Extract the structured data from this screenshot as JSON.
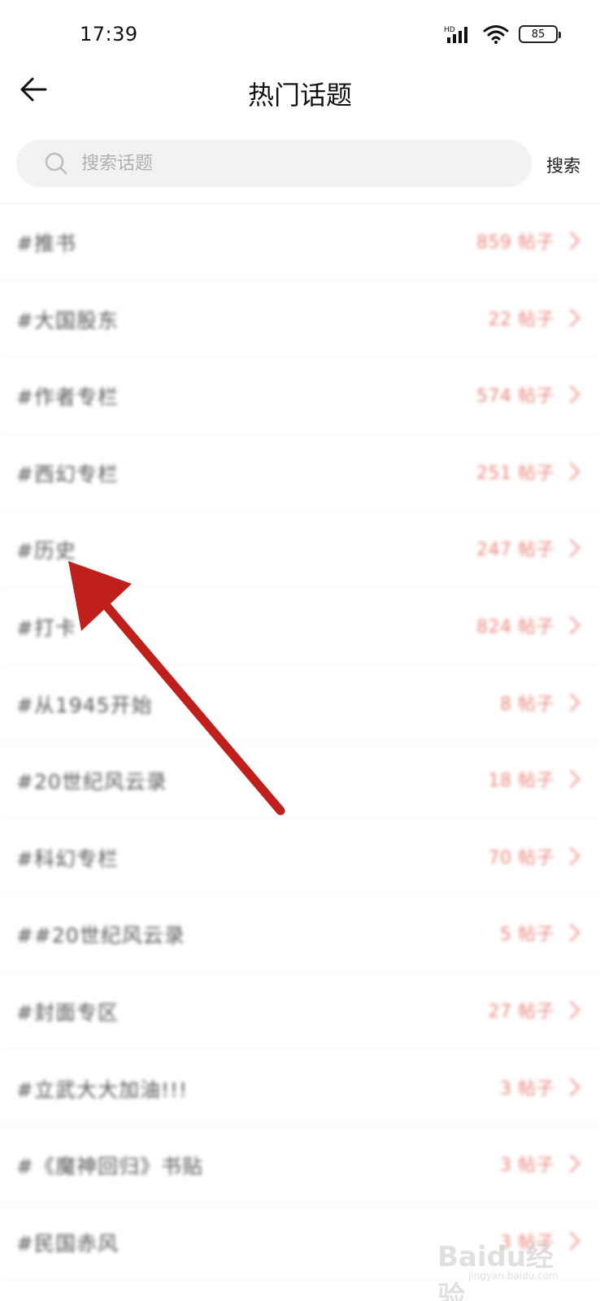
{
  "status_bar": {
    "time": "17:39",
    "network": "HD",
    "battery": "85"
  },
  "header": {
    "title": "热门话题",
    "back_icon": "back-arrow-icon"
  },
  "search": {
    "placeholder": "搜索话题",
    "button_label": "搜索",
    "icon": "search-icon"
  },
  "topics": [
    {
      "name": "#推书",
      "count": "859 帖子"
    },
    {
      "name": "#大国股东",
      "count": "22 帖子"
    },
    {
      "name": "#作者专栏",
      "count": "574 帖子"
    },
    {
      "name": "#西幻专栏",
      "count": "251 帖子"
    },
    {
      "name": "#历史",
      "count": "247 帖子"
    },
    {
      "name": "#打卡",
      "count": "824 帖子"
    },
    {
      "name": "#从1945开始",
      "count": "8 帖子"
    },
    {
      "name": "#20世纪风云录",
      "count": "18 帖子"
    },
    {
      "name": "#科幻专栏",
      "count": "70 帖子"
    },
    {
      "name": "##20世纪风云录",
      "count": "5 帖子"
    },
    {
      "name": "#封面专区",
      "count": "27 帖子"
    },
    {
      "name": "#立武大大加油!!!",
      "count": "3 帖子"
    },
    {
      "name": "#《魔神回归》书贴",
      "count": "3 帖子"
    },
    {
      "name": "#民国赤风",
      "count": "3 帖子"
    }
  ],
  "watermark": {
    "brand": "Baidu经验",
    "sub": "jingyan.baidu.com"
  },
  "colors": {
    "count_text": "#e8857c",
    "annotation_arrow": "#c0201c"
  }
}
